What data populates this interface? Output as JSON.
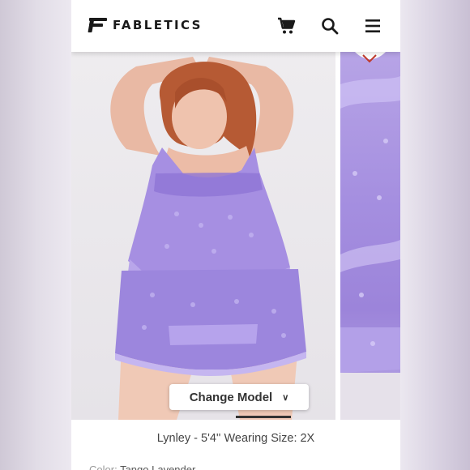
{
  "header": {
    "brand": "FABLETICS",
    "icons": [
      "cart-icon",
      "search-icon",
      "menu-icon"
    ]
  },
  "gallery": {
    "change_model_label": "Change Model",
    "model_caption": "Lynley - 5'4'' Wearing Size: 2X"
  },
  "product": {
    "color_label": "Color:",
    "color_value": "Tango Lavender"
  },
  "colors": {
    "lavender": "#a58fe0",
    "text_dark": "#1a1a1a"
  }
}
